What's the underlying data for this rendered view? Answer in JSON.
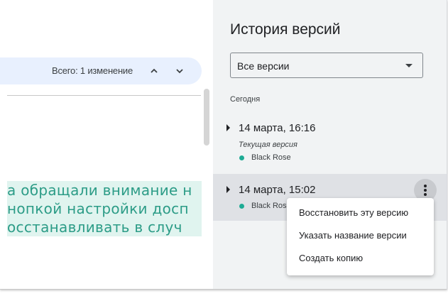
{
  "changes": {
    "count_text": "Всего: 1 изменение"
  },
  "document": {
    "lines": [
      "а обращали внимание н",
      "нопкой настройки досп",
      "осстанавливать в случ"
    ]
  },
  "panel": {
    "title": "История версий",
    "filter": {
      "selected": "Все версии"
    },
    "section_label": "Сегодня",
    "versions": [
      {
        "date": "14 марта, 16:16",
        "subtitle": "Текущая версия",
        "author": "Black Rose"
      },
      {
        "date": "14 марта, 15:02",
        "author": "Black Rose"
      }
    ]
  },
  "context_menu": {
    "items": [
      "Восстановить эту версию",
      "Указать название версии",
      "Создать копию"
    ]
  },
  "colors": {
    "accent_highlight": "#e0f4ef",
    "author_dot": "#1eab94",
    "changes_bar": "#e8f0fe"
  }
}
